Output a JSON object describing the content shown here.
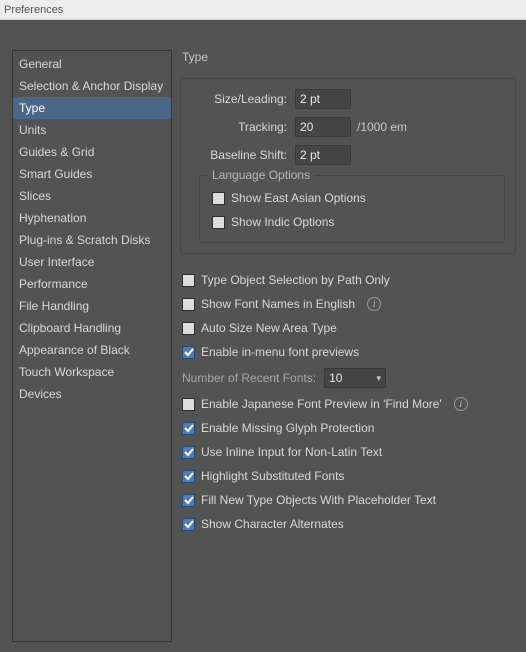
{
  "window": {
    "title": "Preferences"
  },
  "sidebar": {
    "items": [
      {
        "label": "General"
      },
      {
        "label": "Selection & Anchor Display"
      },
      {
        "label": "Type"
      },
      {
        "label": "Units"
      },
      {
        "label": "Guides & Grid"
      },
      {
        "label": "Smart Guides"
      },
      {
        "label": "Slices"
      },
      {
        "label": "Hyphenation"
      },
      {
        "label": "Plug-ins & Scratch Disks"
      },
      {
        "label": "User Interface"
      },
      {
        "label": "Performance"
      },
      {
        "label": "File Handling"
      },
      {
        "label": "Clipboard Handling"
      },
      {
        "label": "Appearance of Black"
      },
      {
        "label": "Touch Workspace"
      },
      {
        "label": "Devices"
      }
    ],
    "selected_index": 2
  },
  "panel": {
    "title": "Type",
    "fields": {
      "size_leading": {
        "label": "Size/Leading:",
        "value": "2 pt"
      },
      "tracking": {
        "label": "Tracking:",
        "value": "20",
        "suffix": "/1000 em"
      },
      "baseline": {
        "label": "Baseline Shift:",
        "value": "2 pt"
      }
    },
    "language_options": {
      "legend": "Language Options",
      "east_asian": {
        "label": "Show East Asian Options",
        "checked": false
      },
      "indic": {
        "label": "Show Indic Options",
        "checked": false
      }
    },
    "opts": {
      "path_only": {
        "label": "Type Object Selection by Path Only",
        "checked": false
      },
      "font_english": {
        "label": "Show Font Names in English",
        "checked": false,
        "info": true
      },
      "auto_size": {
        "label": "Auto Size New Area Type",
        "checked": false
      },
      "font_previews": {
        "label": "Enable in-menu font previews",
        "checked": true
      }
    },
    "recent": {
      "label": "Number of Recent Fonts:",
      "value": "10"
    },
    "opts2": {
      "jp_preview": {
        "label": "Enable Japanese Font Preview in 'Find More'",
        "checked": false,
        "info": true
      },
      "missing_glyph": {
        "label": "Enable Missing Glyph Protection",
        "checked": true
      },
      "inline_input": {
        "label": "Use Inline Input for Non-Latin Text",
        "checked": true
      },
      "highlight_sub": {
        "label": "Highlight Substituted Fonts",
        "checked": true
      },
      "placeholder": {
        "label": "Fill New Type Objects With Placeholder Text",
        "checked": true
      },
      "char_alt": {
        "label": "Show Character Alternates",
        "checked": true
      }
    }
  }
}
